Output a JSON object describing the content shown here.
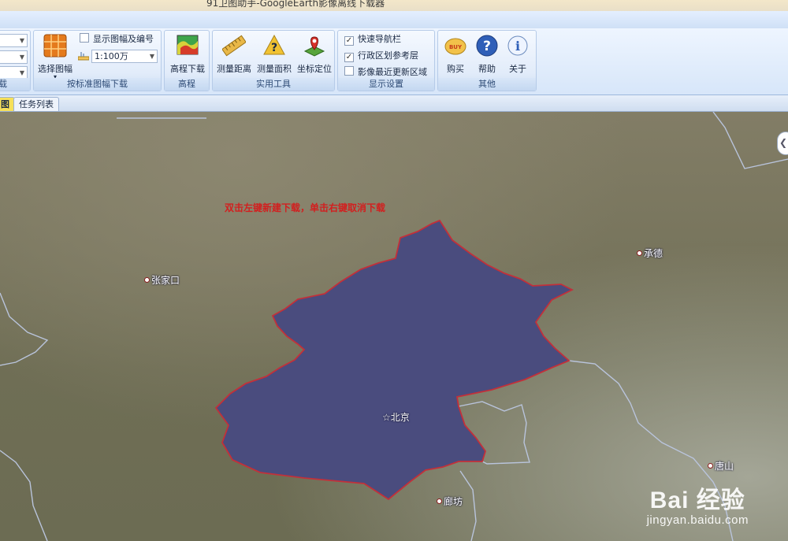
{
  "window": {
    "title": "91卫图助手-GoogleEarth影像离线下载器"
  },
  "ribbon": {
    "partial_group": {
      "label": "载"
    },
    "standard_download": {
      "label": "按标准图幅下载",
      "select_sheet": "选择图幅",
      "show_sheet_checkbox": "显示图幅及编号",
      "scale_value": "1:100万"
    },
    "elevation": {
      "label": "高程",
      "download_button": "高程下载"
    },
    "tools": {
      "label": "实用工具",
      "measure_distance": "测量距离",
      "measure_area": "测量面积",
      "coord_locate": "坐标定位"
    },
    "display": {
      "label": "显示设置",
      "quick_nav": {
        "text": "快速导航栏",
        "checked": true
      },
      "admin_layer": {
        "text": "行政区划参考层",
        "checked": true
      },
      "recent_update": {
        "text": "影像最近更新区域",
        "checked": false
      }
    },
    "other": {
      "label": "其他",
      "buy": "购买",
      "help": "帮助",
      "about": "关于"
    }
  },
  "tabs": [
    {
      "label": "图"
    },
    {
      "label": "任务列表"
    }
  ],
  "map": {
    "hint": "双击左键新建下载，单击右键取消下载",
    "cities": {
      "zhangjiakou": "张家口",
      "chengde": "承德",
      "beijing": "北京",
      "tangshan": "唐山",
      "langfang": "廊坊"
    }
  },
  "watermark": {
    "main": "Bai 经验",
    "sub": "jingyan.baidu.com"
  },
  "colors": {
    "region_fill": "#4a4c7e",
    "region_border": "#c2303a",
    "boundary_lines": "#b9c4dc"
  }
}
